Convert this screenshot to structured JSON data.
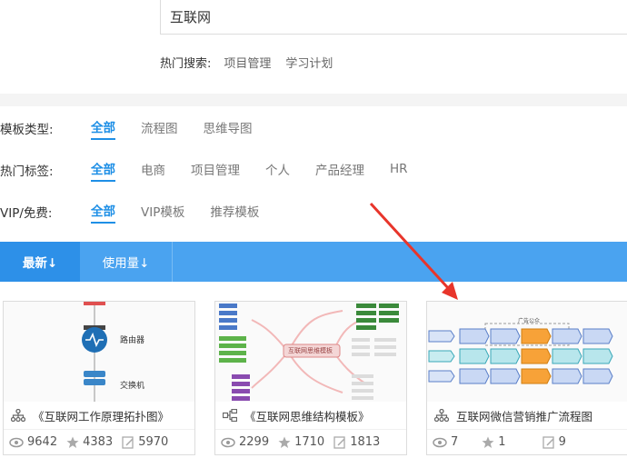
{
  "search": {
    "value": "互联网"
  },
  "hot_search": {
    "label": "热门搜索:",
    "keywords": [
      "项目管理",
      "学习计划"
    ]
  },
  "filters": {
    "type": {
      "label": "模板类型:",
      "options": [
        "全部",
        "流程图",
        "思维导图"
      ]
    },
    "tags": {
      "label": "热门标签:",
      "options": [
        "全部",
        "电商",
        "项目管理",
        "个人",
        "产品经理",
        "HR"
      ]
    },
    "vip": {
      "label": "VIP/免费:",
      "options": [
        "全部",
        "VIP模板",
        "推荐模板"
      ]
    }
  },
  "sort": {
    "newest": "最新↓",
    "usage": "使用量↓"
  },
  "cards": [
    {
      "title": "《互联网工作原理拓扑图》",
      "views": "9642",
      "stars": "4383",
      "edits": "5970",
      "thumb": {
        "node1": "路由器",
        "node2": "交换机"
      }
    },
    {
      "title": "《互联网思维结构模板》",
      "views": "2299",
      "stars": "1710",
      "edits": "1813",
      "thumb": {
        "center": "互联网思维模板"
      }
    },
    {
      "title": "互联网微信营销推广流程图",
      "views": "7",
      "stars": "1",
      "edits": "9",
      "thumb": {
        "header": "广告公众"
      }
    }
  ],
  "colors": {
    "accent": "#1e8fe6",
    "sortbar": "#4aa3f0",
    "annotation_arrow": "#e8352b"
  }
}
